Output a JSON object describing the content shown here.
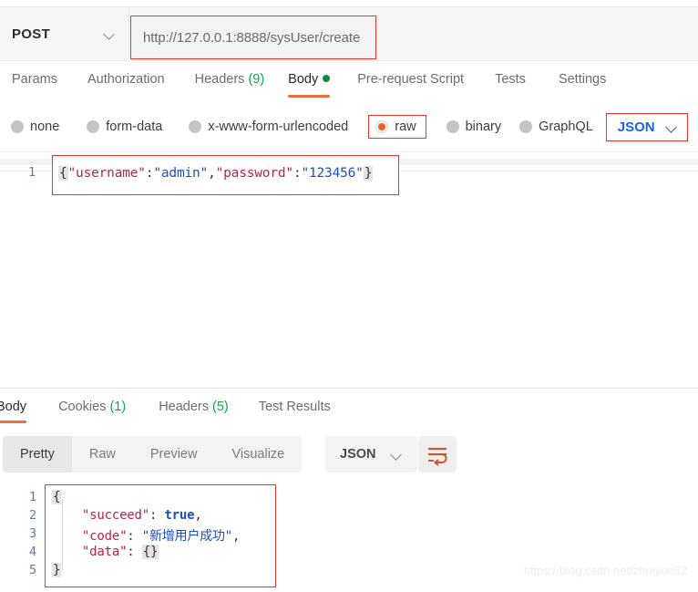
{
  "request": {
    "method": "POST",
    "url": "http://127.0.0.1:8888/sysUser/create",
    "url_placeholder": "Enter request URL",
    "method_chevron_icon": "chevron-down-icon",
    "tabs": [
      {
        "label": "Params",
        "badge": "",
        "active": false
      },
      {
        "label": "Authorization",
        "badge": "",
        "active": false
      },
      {
        "label": "Headers",
        "badge": "(9)",
        "active": false
      },
      {
        "label": "Body",
        "badge": "",
        "active": true,
        "dot": "green-dot-icon"
      },
      {
        "label": "Pre-request Script",
        "badge": "",
        "active": false
      },
      {
        "label": "Tests",
        "badge": "",
        "active": false
      },
      {
        "label": "Settings",
        "badge": "",
        "active": false
      }
    ],
    "body_types": [
      {
        "label": "none",
        "selected": false
      },
      {
        "label": "form-data",
        "selected": false
      },
      {
        "label": "x-www-form-urlencoded",
        "selected": false
      },
      {
        "label": "raw",
        "selected": true
      },
      {
        "label": "binary",
        "selected": false
      },
      {
        "label": "GraphQL",
        "selected": false
      }
    ],
    "format_select": {
      "value": "JSON",
      "chevron_icon": "chevron-down-icon"
    },
    "editor": {
      "line_numbers": [
        "1"
      ],
      "tokens": [
        {
          "t": "{",
          "k": "brace"
        },
        {
          "t": "\"username\"",
          "k": "key"
        },
        {
          "t": ":",
          "k": "punc"
        },
        {
          "t": "\"admin\"",
          "k": "str"
        },
        {
          "t": ",",
          "k": "punc"
        },
        {
          "t": "\"password\"",
          "k": "key"
        },
        {
          "t": ":",
          "k": "punc"
        },
        {
          "t": "\"123456\"",
          "k": "str"
        },
        {
          "t": "}",
          "k": "brace"
        }
      ]
    }
  },
  "response": {
    "tabs": [
      {
        "label": "Body",
        "badge": "",
        "active": true
      },
      {
        "label": "Cookies",
        "badge": "(1)",
        "active": false
      },
      {
        "label": "Headers",
        "badge": "(5)",
        "active": false
      },
      {
        "label": "Test Results",
        "badge": "",
        "active": false
      }
    ],
    "view_modes": [
      {
        "label": "Pretty",
        "active": true
      },
      {
        "label": "Raw",
        "active": false
      },
      {
        "label": "Preview",
        "active": false
      },
      {
        "label": "Visualize",
        "active": false
      }
    ],
    "format_select": {
      "value": "JSON",
      "chevron_icon": "chevron-down-icon"
    },
    "wrap_button_icon": "word-wrap-icon",
    "body": {
      "line_numbers": [
        "1",
        "2",
        "3",
        "4",
        "5"
      ],
      "lines": [
        [
          {
            "t": "{",
            "k": "brace"
          }
        ],
        [
          {
            "t": "    ",
            "k": "punc"
          },
          {
            "t": "\"succeed\"",
            "k": "key"
          },
          {
            "t": ": ",
            "k": "punc"
          },
          {
            "t": "true",
            "k": "bool"
          },
          {
            "t": ",",
            "k": "punc"
          }
        ],
        [
          {
            "t": "    ",
            "k": "punc"
          },
          {
            "t": "\"code\"",
            "k": "key"
          },
          {
            "t": ": ",
            "k": "punc"
          },
          {
            "t": "\"新增用户成功\"",
            "k": "str"
          },
          {
            "t": ",",
            "k": "punc"
          }
        ],
        [
          {
            "t": "    ",
            "k": "punc"
          },
          {
            "t": "\"data\"",
            "k": "key"
          },
          {
            "t": ": ",
            "k": "punc"
          },
          {
            "t": "{}",
            "k": "brace"
          }
        ],
        [
          {
            "t": "}",
            "k": "brace"
          }
        ]
      ]
    }
  },
  "watermark": "https://blog.csdn.net/zhuiyue82",
  "colors": {
    "accent_orange": "#ef6c3e",
    "highlight_red": "#e8352c",
    "badge_green": "#16a34a",
    "link_blue": "#1a63e8",
    "json_key": "#b5264a",
    "json_string": "#1a4fc4"
  }
}
